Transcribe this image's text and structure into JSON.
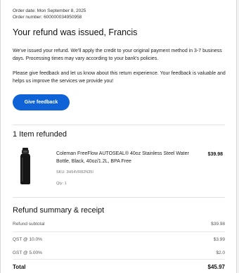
{
  "order": {
    "date_text": "Order date: Mon September 8, 2025",
    "number_text": "Order number: 600000034950958"
  },
  "headline": "Your refund was issued, Francis",
  "paragraphs": {
    "issued": "We've issued your refund. We'll apply the credit to your original payment method in 3-7 business days. Processing times may vary according to your bank's policies.",
    "feedback": "Please give feedback and let us know about this return experience. Your feedback is valuable and helps us improve the services we provide you!"
  },
  "feedback_button_label": "Give feedback",
  "items_section": {
    "title": "1 Item refunded",
    "items": [
      {
        "name": "Coleman FreeFlow AUTOSEAL® 40oz Stainless Steel Water Bottle, Black, 40oz/1.2L, BPA Free",
        "price": "$39.98",
        "sku": "SKU: 3H54VR82N35I",
        "qty": "Qty: 1",
        "icon": "water-bottle-image"
      }
    ]
  },
  "summary": {
    "title": "Refund summary & receipt",
    "rows": [
      {
        "label": "Refund subtotal",
        "value": "$39.98"
      },
      {
        "label": "QST @ 10.0%",
        "value": "$3.99"
      },
      {
        "label": "GST @ 5.00%",
        "value": "$2.0"
      }
    ],
    "total_label": "Total",
    "total_value": "$45.97"
  },
  "colors": {
    "accent": "#0f63d6",
    "divider": "#e1e1e1",
    "background": "#f2f2f2"
  }
}
